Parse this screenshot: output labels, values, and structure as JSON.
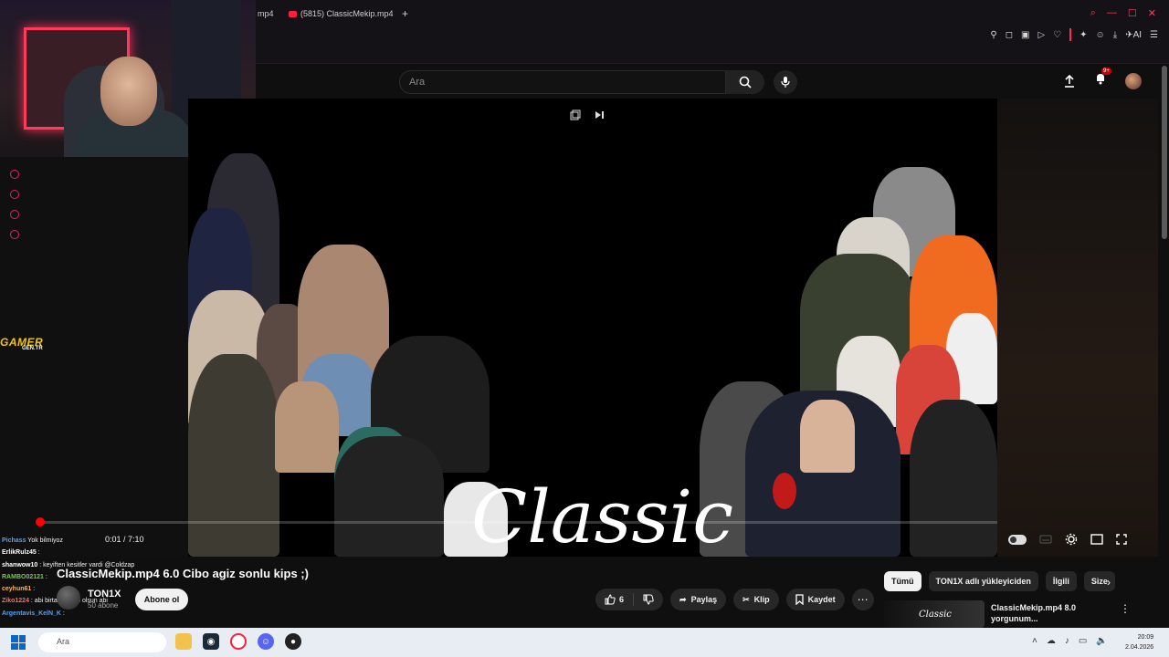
{
  "browser": {
    "tabs": [
      {
        "label": "mp4"
      },
      {
        "label": "(5815) ClassicMekip.mp4"
      }
    ],
    "ai_label": "AI"
  },
  "header": {
    "search_placeholder": "Ara",
    "notification_badge": "9+"
  },
  "overlay": {
    "logo_text": "GAMER",
    "logo_sub": "GEN.TR"
  },
  "video": {
    "overlay_text": "Classic",
    "timecode": "0:01 / 7:10",
    "progress_fraction": 0.0023,
    "title": "ClassicMekip.mp4 6.0 Cibo agiz sonlu kips ;)"
  },
  "channel": {
    "name": "TON1X",
    "subscribers": "50 abone",
    "subscribe_label": "Abone ol"
  },
  "actions": {
    "like_count": "6",
    "share_label": "Paylaş",
    "clip_label": "Klip",
    "save_label": "Kaydet"
  },
  "chips": [
    {
      "label": "Tümü",
      "active": true
    },
    {
      "label": "TON1X adlı yükleyiciden",
      "active": false
    },
    {
      "label": "İlgili",
      "active": false
    },
    {
      "label": "Size",
      "active": false
    }
  ],
  "recommendation": {
    "thumb_text": "Classic",
    "title": "ClassicMekip.mp4 8.0 yorgunum..."
  },
  "chat": [
    {
      "user": "Pichass",
      "text": "Yok bilmiyoz",
      "color": "#4aa3ff"
    },
    {
      "user": "ErlikRulz45",
      "text": ":",
      "color": "#ffffff"
    },
    {
      "user": "shanwow10",
      "text": ": keyiften kesitler vardi @Coldzap",
      "color": "#ffffff"
    },
    {
      "user": "RAMBO02121",
      "text": ":",
      "color": "#7ac943"
    },
    {
      "user": "ceyhun61",
      "text": ":",
      "color": "#ffb347"
    },
    {
      "user": "Ziko1224",
      "text": ": abi birtane dodo olsun abi",
      "color": "#ff6b6b"
    },
    {
      "user": "Argentavis_KelN_K",
      "text": ":",
      "color": "#4aa3ff"
    },
    {
      "user": "",
      "text": "",
      "color": "#c080ff"
    }
  ],
  "taskbar": {
    "search_placeholder": "Ara",
    "time": "20:09",
    "date": "2.04.2026"
  }
}
